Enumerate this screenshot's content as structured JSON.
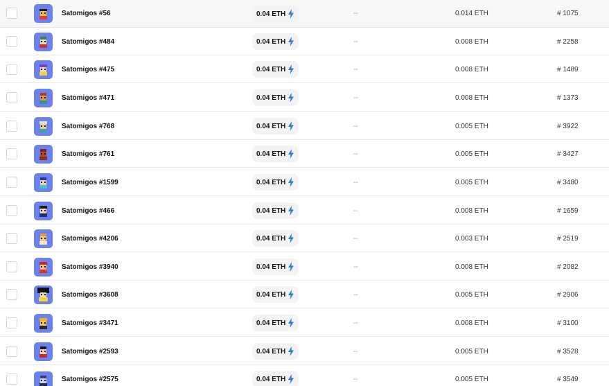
{
  "colors": {
    "thumb_bg": "#6b82ee",
    "bolt": "#2d7de0",
    "row_border": "#e6e6e6",
    "pill_bg": "#f3f3f5"
  },
  "rows": [
    {
      "name": "Satomigos #56",
      "price": "0.04 ETH",
      "floor": "--",
      "last_sale": "0.014 ETH",
      "rank": "# 1075"
    },
    {
      "name": "Satomigos #484",
      "price": "0.04 ETH",
      "floor": "--",
      "last_sale": "0.008 ETH",
      "rank": "# 2258"
    },
    {
      "name": "Satomigos #475",
      "price": "0.04 ETH",
      "floor": "--",
      "last_sale": "0.008 ETH",
      "rank": "# 1489"
    },
    {
      "name": "Satomigos #471",
      "price": "0.04 ETH",
      "floor": "--",
      "last_sale": "0.008 ETH",
      "rank": "# 1373"
    },
    {
      "name": "Satomigos #768",
      "price": "0.04 ETH",
      "floor": "--",
      "last_sale": "0.005 ETH",
      "rank": "# 3922"
    },
    {
      "name": "Satomigos #761",
      "price": "0.04 ETH",
      "floor": "--",
      "last_sale": "0.005 ETH",
      "rank": "# 3427"
    },
    {
      "name": "Satomigos #1599",
      "price": "0.04 ETH",
      "floor": "--",
      "last_sale": "0.005 ETH",
      "rank": "# 3480"
    },
    {
      "name": "Satomigos #466",
      "price": "0.04 ETH",
      "floor": "--",
      "last_sale": "0.008 ETH",
      "rank": "# 1659"
    },
    {
      "name": "Satomigos #4206",
      "price": "0.04 ETH",
      "floor": "--",
      "last_sale": "0.003 ETH",
      "rank": "# 2519"
    },
    {
      "name": "Satomigos #3940",
      "price": "0.04 ETH",
      "floor": "--",
      "last_sale": "0.008 ETH",
      "rank": "# 2082"
    },
    {
      "name": "Satomigos #3608",
      "price": "0.04 ETH",
      "floor": "--",
      "last_sale": "0.005 ETH",
      "rank": "# 2906"
    },
    {
      "name": "Satomigos #3471",
      "price": "0.04 ETH",
      "floor": "--",
      "last_sale": "0.008 ETH",
      "rank": "# 3100"
    },
    {
      "name": "Satomigos #2593",
      "price": "0.04 ETH",
      "floor": "--",
      "last_sale": "0.005 ETH",
      "rank": "# 3528"
    },
    {
      "name": "Satomigos #2575",
      "price": "0.04 ETH",
      "floor": "--",
      "last_sale": "0.005 ETH",
      "rank": "# 3549"
    }
  ]
}
